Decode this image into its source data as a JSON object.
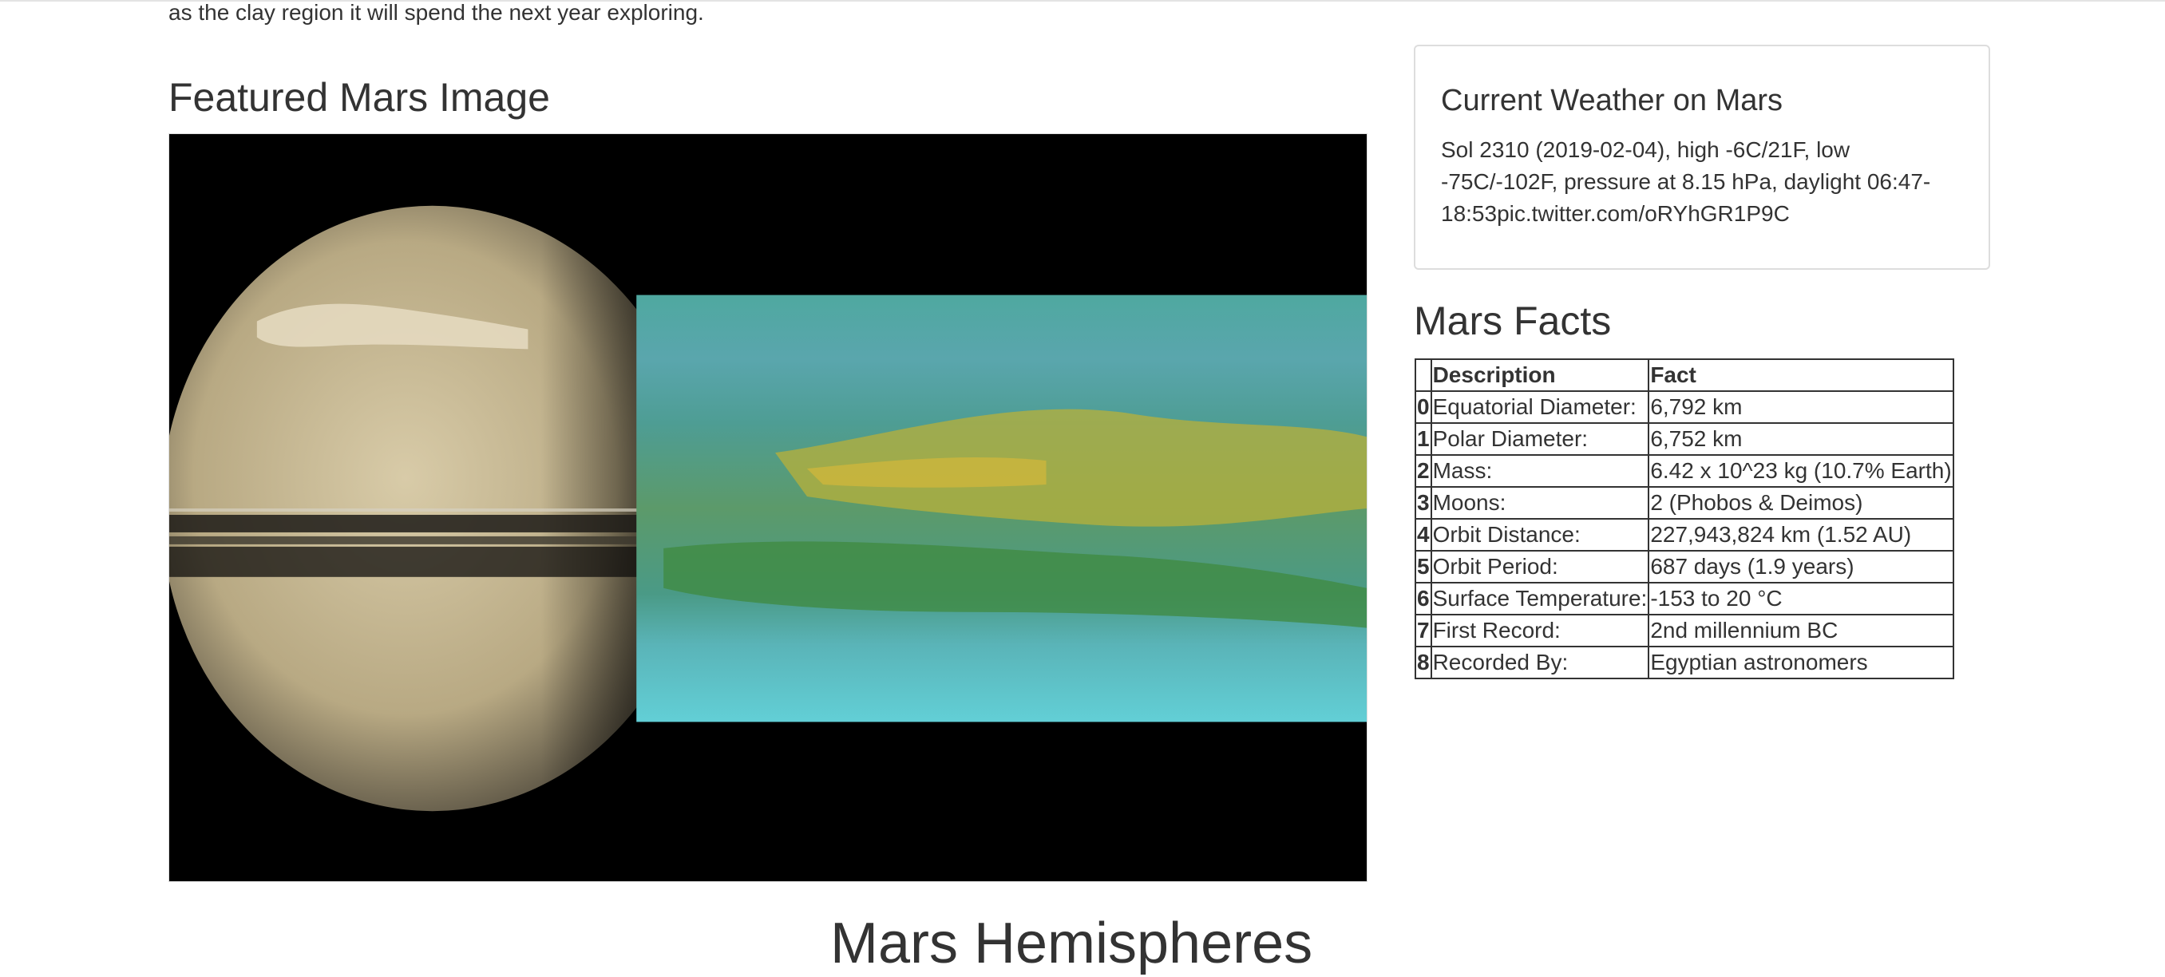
{
  "intro": {
    "tail_text": "as the clay region it will spend the next year exploring."
  },
  "featured": {
    "title": "Featured Mars Image"
  },
  "weather": {
    "title": "Current Weather on Mars",
    "text": "Sol 2310 (2019-02-04), high -6C/21F, low -75C/-102F, pressure at 8.15 hPa, daylight 06:47-18:53pic.twitter.com/oRYhGR1P9C"
  },
  "facts": {
    "title": "Mars Facts",
    "headers": [
      "",
      "Description",
      "Fact"
    ],
    "rows": [
      {
        "idx": "0",
        "description": "Equatorial Diameter:",
        "fact": "6,792 km"
      },
      {
        "idx": "1",
        "description": "Polar Diameter:",
        "fact": "6,752 km"
      },
      {
        "idx": "2",
        "description": "Mass:",
        "fact": "6.42 x 10^23 kg (10.7% Earth)"
      },
      {
        "idx": "3",
        "description": "Moons:",
        "fact": "2 (Phobos & Deimos)"
      },
      {
        "idx": "4",
        "description": "Orbit Distance:",
        "fact": "227,943,824 km (1.52 AU)"
      },
      {
        "idx": "5",
        "description": "Orbit Period:",
        "fact": "687 days (1.9 years)"
      },
      {
        "idx": "6",
        "description": "Surface Temperature:",
        "fact": "-153 to 20 °C"
      },
      {
        "idx": "7",
        "description": "First Record:",
        "fact": "2nd millennium BC"
      },
      {
        "idx": "8",
        "description": "Recorded By:",
        "fact": "Egyptian astronomers"
      }
    ]
  },
  "hemispheres": {
    "title": "Mars Hemispheres"
  }
}
